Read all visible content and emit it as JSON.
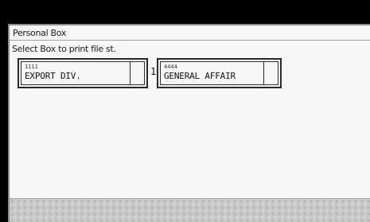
{
  "window": {
    "title": "Personal Box"
  },
  "instruction": "Select Box to print file st.",
  "boxes": [
    {
      "number": "1111",
      "name": "EXPORT DIV."
    },
    {
      "number": "4444",
      "name": "GENERAL AFFAIR"
    }
  ],
  "page_marker": "1"
}
